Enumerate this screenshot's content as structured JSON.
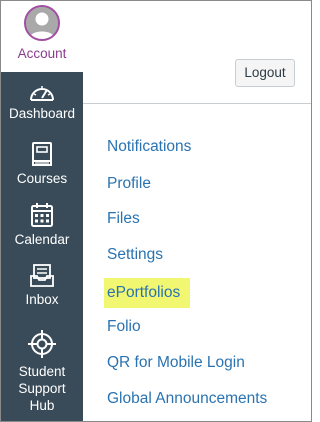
{
  "global_nav": {
    "account": {
      "label": "Account",
      "icon": "avatar-icon",
      "accent_color": "#8b3c8f"
    },
    "items": [
      {
        "label": "Dashboard",
        "icon": "dashboard-speedometer-icon"
      },
      {
        "label": "Courses",
        "icon": "courses-book-icon"
      },
      {
        "label": "Calendar",
        "icon": "calendar-icon"
      },
      {
        "label": "Inbox",
        "icon": "inbox-tray-icon"
      },
      {
        "label_lines": [
          "Student",
          "Support",
          "Hub"
        ],
        "icon": "support-lifebuoy-icon"
      }
    ],
    "background_color": "#394b58"
  },
  "account_panel": {
    "logout_label": "Logout",
    "links": [
      "Notifications",
      "Profile",
      "Files",
      "Settings",
      "ePortfolios",
      "Folio",
      "QR for Mobile Login",
      "Global Announcements"
    ],
    "highlighted_link": "ePortfolios",
    "highlight_color": "#f1f771",
    "link_color": "#2a73b0"
  }
}
